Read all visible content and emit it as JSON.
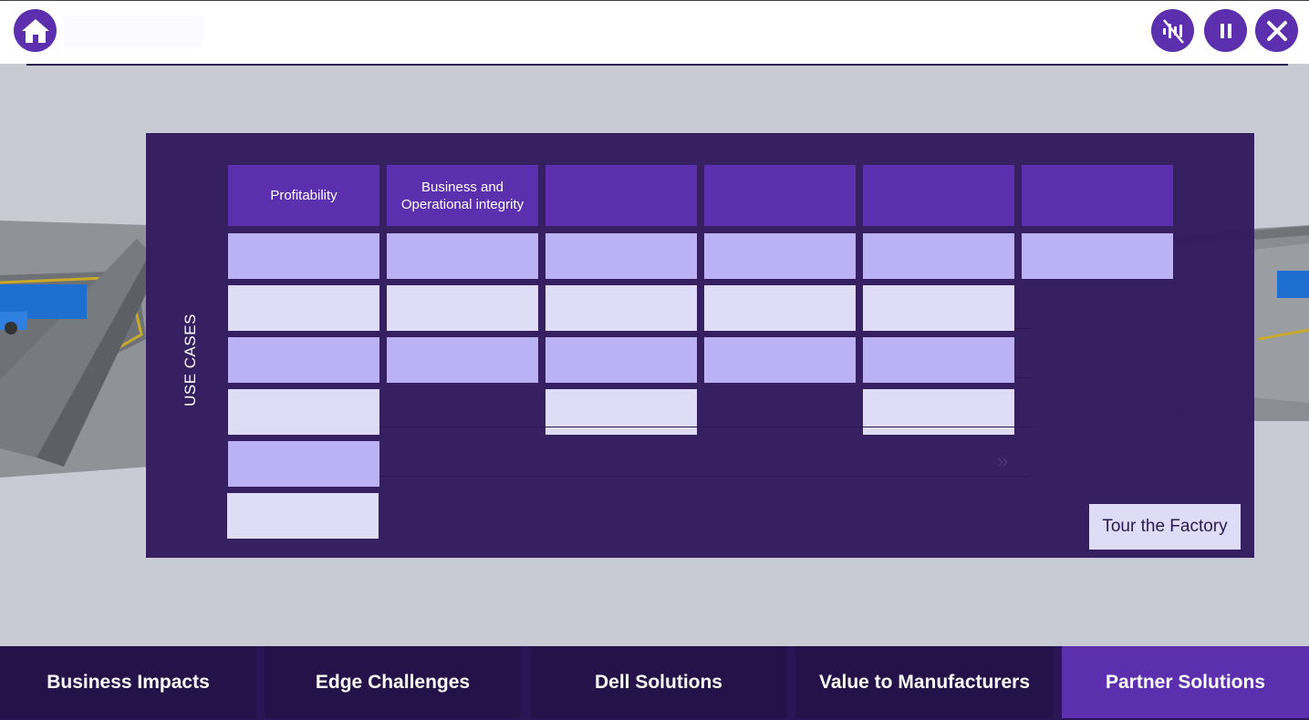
{
  "header": {
    "title": "",
    "buttons": [
      {
        "name": "home",
        "icon": "home-icon"
      },
      {
        "name": "mute",
        "icon": "audio-off-icon"
      },
      {
        "name": "pause",
        "icon": "pause-icon"
      },
      {
        "name": "close",
        "icon": "close-icon"
      }
    ]
  },
  "panel": {
    "side_label": "USE CASES",
    "columns": [
      {
        "label": "Profitability"
      },
      {
        "label": "Business and\nOperational integrity"
      },
      {
        "label": ""
      },
      {
        "label": ""
      },
      {
        "label": ""
      },
      {
        "label": ""
      }
    ],
    "tour_button": "Tour the Factory"
  },
  "nav": {
    "tabs": [
      {
        "label": "Business Impacts",
        "active": false
      },
      {
        "label": "Edge Challenges",
        "active": false
      },
      {
        "label": "Dell Solutions",
        "active": false
      },
      {
        "label": "Value to Manufacturers",
        "active": false
      },
      {
        "label": "Partner Solutions",
        "active": true
      }
    ]
  },
  "colors": {
    "brand_purple": "#5b2fad",
    "panel_bg": "#341d60",
    "cell_dark": "#bbb2f6",
    "cell_light": "#dfdcf7"
  }
}
